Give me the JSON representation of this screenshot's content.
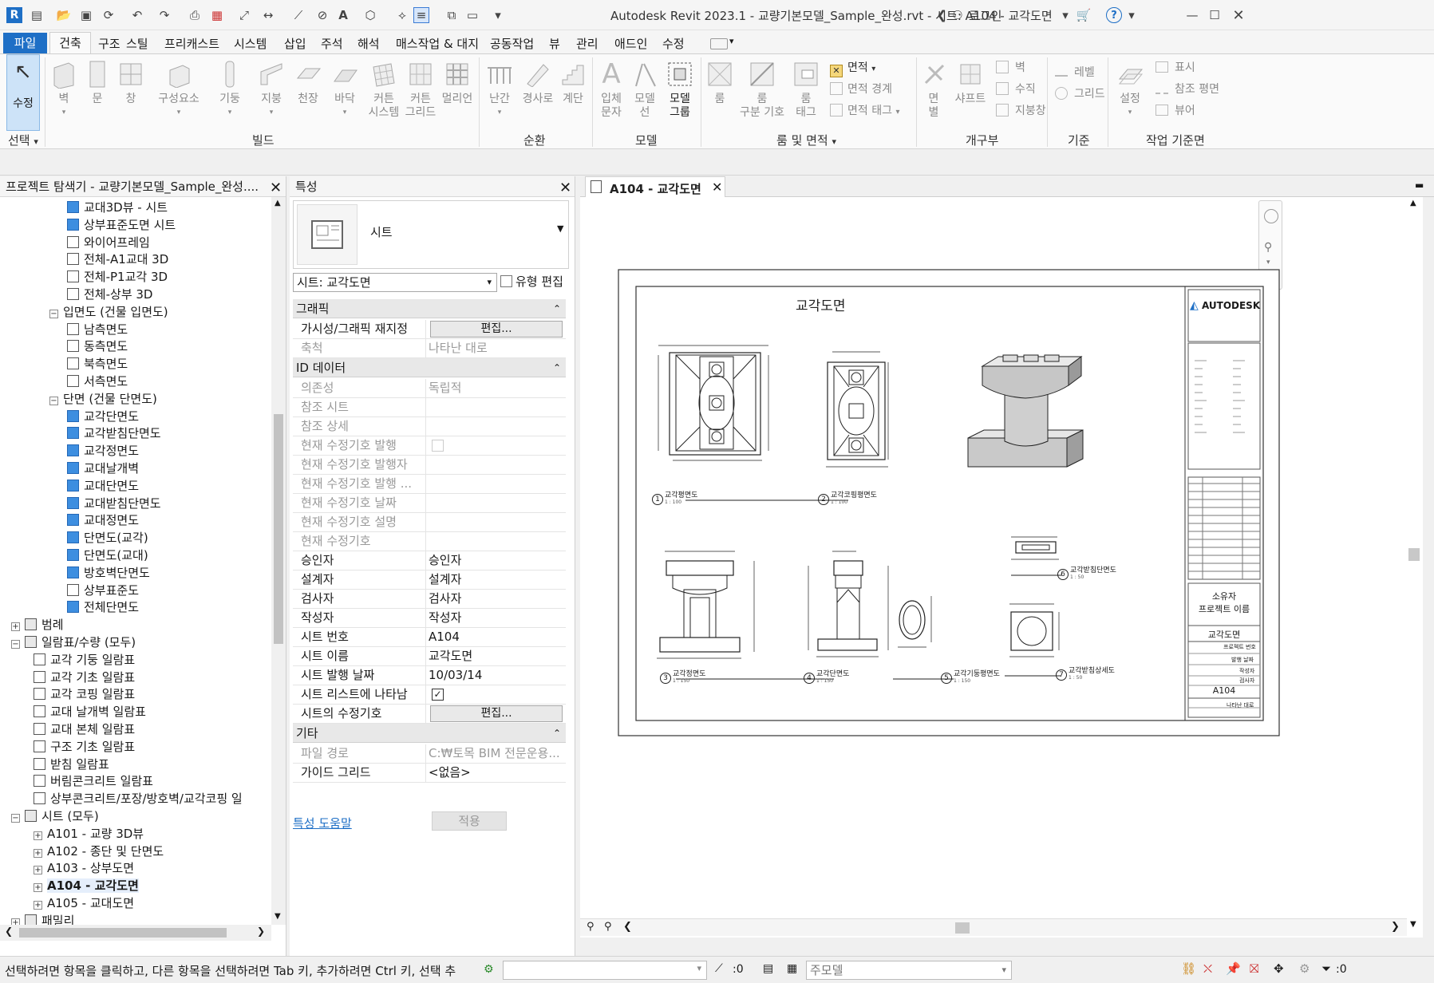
{
  "titlebar": {
    "title": "Autodesk Revit 2023.1 - 교량기본모델_Sample_완성.rvt - 시트: A104 - 교각도면",
    "login": "로그인",
    "icons": [
      "revit-logo-icon",
      "open-icon",
      "save-icon",
      "sync-icon",
      "undo-icon",
      "redo-icon",
      "print-icon",
      "pdf-icon"
    ]
  },
  "menu": {
    "file": "파일",
    "items": [
      "건축",
      "구조",
      "스틸",
      "프리캐스트",
      "시스템",
      "삽입",
      "주석",
      "해석",
      "매스작업 & 대지",
      "공동작업",
      "뷰",
      "관리",
      "애드인",
      "수정"
    ]
  },
  "ribbon": {
    "modify": "수정",
    "select": "선택",
    "build_buttons": [
      "벽",
      "문",
      "창",
      "구성요소",
      "기둥",
      "지붕",
      "천장",
      "바닥",
      "커튼\n시스템",
      "커튼\n그리드",
      "멀리언"
    ],
    "circulation_buttons": [
      "난간",
      "경사로",
      "계단"
    ],
    "model_buttons": [
      "입체\n문자",
      "모델\n선",
      "모델\n그룹"
    ],
    "room_buttons": [
      "룸",
      "룸\n구분 기호",
      "룸\n태그"
    ],
    "area_items": [
      "면적",
      "면적 경계",
      "면적 태그"
    ],
    "opening_buttons": [
      "면\n별",
      "샤프트"
    ],
    "opening_small": [
      "벽",
      "수직",
      "지붕창"
    ],
    "datum_small": [
      "레벨",
      "그리드"
    ],
    "workplane_button": "설정",
    "workplane_small": [
      "표시",
      "참조 평면",
      "뷰어"
    ],
    "panels": [
      "빌드",
      "순환",
      "모델",
      "룸 및 면적",
      "개구부",
      "기준",
      "작업 기준면"
    ]
  },
  "browser": {
    "title": "프로젝트 탐색기 - 교량기본모델_Sample_완성....",
    "rows": [
      {
        "label": "교대3D뷰 - 시트",
        "level": 3,
        "cb": "blue"
      },
      {
        "label": "상부표준도면 시트",
        "level": 3,
        "cb": "blue"
      },
      {
        "label": "와이어프레임",
        "level": 3,
        "cb": "white"
      },
      {
        "label": "전체-A1교대 3D",
        "level": 3,
        "cb": "white"
      },
      {
        "label": "전체-P1교각 3D",
        "level": 3,
        "cb": "white"
      },
      {
        "label": "전체-상부 3D",
        "level": 3,
        "cb": "white"
      },
      {
        "label": "입면도 (건물 입면도)",
        "level": 2,
        "exp": "−"
      },
      {
        "label": "남측면도",
        "level": 3,
        "cb": "white"
      },
      {
        "label": "동측면도",
        "level": 3,
        "cb": "white"
      },
      {
        "label": "북측면도",
        "level": 3,
        "cb": "white"
      },
      {
        "label": "서측면도",
        "level": 3,
        "cb": "white"
      },
      {
        "label": "단면 (건물 단면도)",
        "level": 2,
        "exp": "−"
      },
      {
        "label": "교각단면도",
        "level": 3,
        "cb": "blue"
      },
      {
        "label": "교각받침단면도",
        "level": 3,
        "cb": "blue"
      },
      {
        "label": "교각정면도",
        "level": 3,
        "cb": "blue"
      },
      {
        "label": "교대날개벽",
        "level": 3,
        "cb": "blue"
      },
      {
        "label": "교대단면도",
        "level": 3,
        "cb": "blue"
      },
      {
        "label": "교대받침단면도",
        "level": 3,
        "cb": "blue"
      },
      {
        "label": "교대정면도",
        "level": 3,
        "cb": "blue"
      },
      {
        "label": "단면도(교각)",
        "level": 3,
        "cb": "blue"
      },
      {
        "label": "단면도(교대)",
        "level": 3,
        "cb": "blue"
      },
      {
        "label": "방호벽단면도",
        "level": 3,
        "cb": "blue"
      },
      {
        "label": "상부표준도",
        "level": 3,
        "cb": "white"
      },
      {
        "label": "전체단면도",
        "level": 3,
        "cb": "blue"
      },
      {
        "label": "범례",
        "level": 0,
        "exp": "+",
        "icon": true
      },
      {
        "label": "일람표/수량 (모두)",
        "level": 0,
        "exp": "−",
        "icon": true
      },
      {
        "label": "교각 기둥 일람표",
        "level": 1,
        "cb": "white"
      },
      {
        "label": "교각 기초 일람표",
        "level": 1,
        "cb": "white"
      },
      {
        "label": "교각 코핑 일람표",
        "level": 1,
        "cb": "white"
      },
      {
        "label": "교대 날개벽 일람표",
        "level": 1,
        "cb": "white"
      },
      {
        "label": "교대 본체 일람표",
        "level": 1,
        "cb": "white"
      },
      {
        "label": "구조 기초 일람표",
        "level": 1,
        "cb": "white"
      },
      {
        "label": "받침 일람표",
        "level": 1,
        "cb": "white"
      },
      {
        "label": "버림콘크리트 일람표",
        "level": 1,
        "cb": "white"
      },
      {
        "label": "상부콘크리트/포장/방호벽/교각코핑 일",
        "level": 1,
        "cb": "white"
      },
      {
        "label": "시트 (모두)",
        "level": 0,
        "exp": "−",
        "icon": true
      },
      {
        "label": "A101 - 교량 3D뷰",
        "level": 1,
        "exp": "+"
      },
      {
        "label": "A102 - 종단 및 단면도",
        "level": 1,
        "exp": "+"
      },
      {
        "label": "A103 - 상부도면",
        "level": 1,
        "exp": "+"
      },
      {
        "label": "A104 - 교각도면",
        "level": 1,
        "exp": "+",
        "selected": true
      },
      {
        "label": "A105 - 교대도면",
        "level": 1,
        "exp": "+"
      },
      {
        "label": "패밀리",
        "level": 0,
        "exp": "+",
        "icon": true
      }
    ]
  },
  "properties": {
    "title": "특성",
    "type_name": "시트",
    "selector": "시트: 교각도면",
    "edit_type": "유형 편집",
    "groups": {
      "graphics": "그래픽",
      "id": "ID 데이터",
      "other": "기타"
    },
    "graphics_rows": [
      {
        "k": "가시성/그래픽 재지정",
        "v": "편집...",
        "button": true
      },
      {
        "k": "축척",
        "v": "나타난 대로",
        "dim": true
      }
    ],
    "id_rows": [
      {
        "k": "의존성",
        "v": "독립적",
        "dim": true
      },
      {
        "k": "참조 시트",
        "v": "",
        "dim": true
      },
      {
        "k": "참조 상세",
        "v": "",
        "dim": true
      },
      {
        "k": "현재 수정기호 발행",
        "v": "",
        "dim": true,
        "check": "empty"
      },
      {
        "k": "현재 수정기호 발행자",
        "v": "",
        "dim": true
      },
      {
        "k": "현재 수정기호 발행 ...",
        "v": "",
        "dim": true
      },
      {
        "k": "현재 수정기호 날짜",
        "v": "",
        "dim": true
      },
      {
        "k": "현재 수정기호 설명",
        "v": "",
        "dim": true
      },
      {
        "k": "현재 수정기호",
        "v": "",
        "dim": true
      },
      {
        "k": "승인자",
        "v": "승인자"
      },
      {
        "k": "설계자",
        "v": "설계자"
      },
      {
        "k": "검사자",
        "v": "검사자"
      },
      {
        "k": "작성자",
        "v": "작성자"
      },
      {
        "k": "시트 번호",
        "v": "A104"
      },
      {
        "k": "시트 이름",
        "v": "교각도면"
      },
      {
        "k": "시트 발행 날짜",
        "v": "10/03/14"
      },
      {
        "k": "시트 리스트에 나타남",
        "v": "",
        "check": "checked"
      },
      {
        "k": "시트의 수정기호",
        "v": "편집...",
        "button": true
      }
    ],
    "other_rows": [
      {
        "k": "파일 경로",
        "v": "C:₩토목 BIM 전문운용...",
        "dim": true
      },
      {
        "k": "가이드 그리드",
        "v": "<없음>"
      }
    ],
    "help": "특성 도움말",
    "apply": "적용"
  },
  "view": {
    "tab": "A104 - 교각도면",
    "sheet": {
      "title": "교각도면",
      "logo": "AUTODESK",
      "owner": "소유자",
      "project": "프로젝트 이름",
      "sheet_name": "교각도면",
      "sheet_number": "A104",
      "tb_labels": [
        "프로젝트 번호",
        "발행 날짜",
        "작성자",
        "검사자"
      ],
      "scale_note": "나타난 대로",
      "views": [
        {
          "num": "1",
          "name": "교각평면도",
          "scale": "1 : 100"
        },
        {
          "num": "2",
          "name": "교각코핑평면도",
          "scale": "1 : 100"
        },
        {
          "num": "3",
          "name": "교각정면도",
          "scale": "1 : 150"
        },
        {
          "num": "4",
          "name": "교각단면도",
          "scale": "1 : 150"
        },
        {
          "num": "5",
          "name": "교각기둥평면도",
          "scale": "1 : 150"
        },
        {
          "num": "6",
          "name": "교각받침단면도",
          "scale": "1 : 50"
        },
        {
          "num": "7",
          "name": "교각받침상세도",
          "scale": "1 : 50"
        }
      ]
    }
  },
  "status": {
    "hint": "선택하려면 항목을 클릭하고, 다른 항목을 선택하려면 Tab 키, 추가하려면 Ctrl 키, 선택 추",
    "zero": ":0",
    "model": "주모델",
    "filter_count": ":0"
  }
}
